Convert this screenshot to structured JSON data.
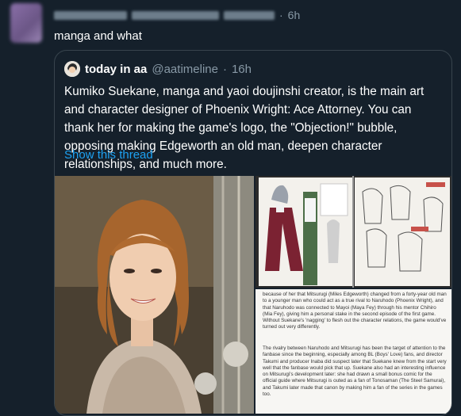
{
  "tweet": {
    "time": "6h",
    "text": "manga and what"
  },
  "quoted": {
    "name": "today in aa",
    "handle": "@aatimeline",
    "time": "16h",
    "text": "Kumiko Suekane, manga and yaoi doujinshi creator, is the main art and character designer of Phoenix Wright: Ace Attorney. You can thank her for making the game's logo, the \"Objection!\" bubble, opposing making Edgeworth an old man, deepen character relationships, and much more.",
    "show_thread": "Show this thread",
    "media_text": {
      "para1": "because of her that Mitsurugi (Miles Edgeworth) changed from a forty-year old man to a younger man who could act as a true rival to Naruhodo (Phoenix Wright), and that Naruhodo was connected to Mayoi (Maya Fey) through his mentor Chihiro (Mia Fey), giving him a personal stake in the second episode of the first game. Without Suekane's 'nagging' to flesh out the character relations, the game would've turned out very differently.",
      "para2": "The rivalry between Naruhodo and Mitsurugi has been the target of attention to the fanbase since the beginning, especially among BL (Boys' Love) fans, and director Takumi and producer Inaba did suspect later that Suekane knew from the start very well that the fanbase would pick that up. Suekane also had an interesting influence on Mitsurugi's development later: she had drawn a small bonus comic for the official guide where Mitsurugi is outed as a fan of Tonosaman (The Steel Samurai), and Takumi later made that canon by making him a fan of the series in the games too."
    }
  },
  "colors": {
    "background": "#15202b",
    "link": "#1da1f2",
    "muted": "#8899a6",
    "border": "#38444d"
  }
}
